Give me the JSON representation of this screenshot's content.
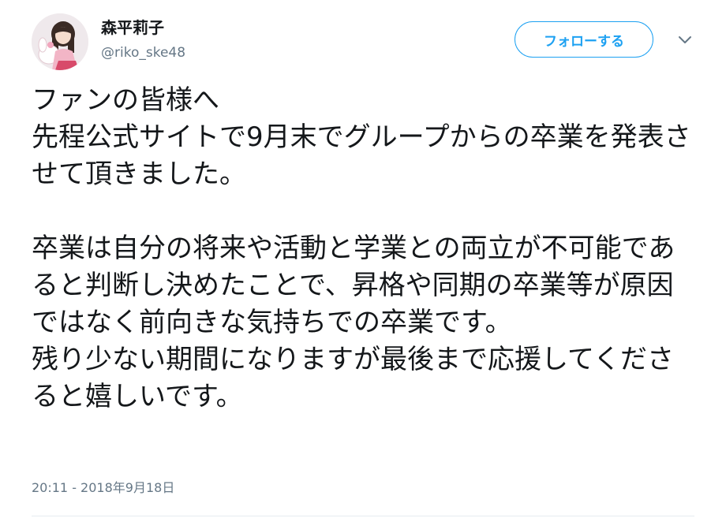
{
  "user": {
    "display_name": "森平莉子",
    "handle": "@riko_ske48"
  },
  "follow_button": {
    "label": "フォローする"
  },
  "tweet": {
    "text": "ファンの皆様へ\n先程公式サイトで9月末でグループからの卒業を発表させて頂きました。\n\n卒業は自分の将来や活動と学業との両立が不可能であると判断し決めたことで、昇格や同期の卒業等が原因ではなく前向きな気持ちでの卒業です。\n残り少ない期間になりますが最後まで応援してくださると嬉しいです。",
    "timestamp": "20:11 - 2018年9月18日"
  },
  "colors": {
    "accent": "#1da1f2",
    "text_primary": "#14171a",
    "text_secondary": "#657786",
    "divider": "#e6ecf0"
  },
  "icons": {
    "menu": "chevron-down-icon",
    "avatar": "profile-photo"
  }
}
